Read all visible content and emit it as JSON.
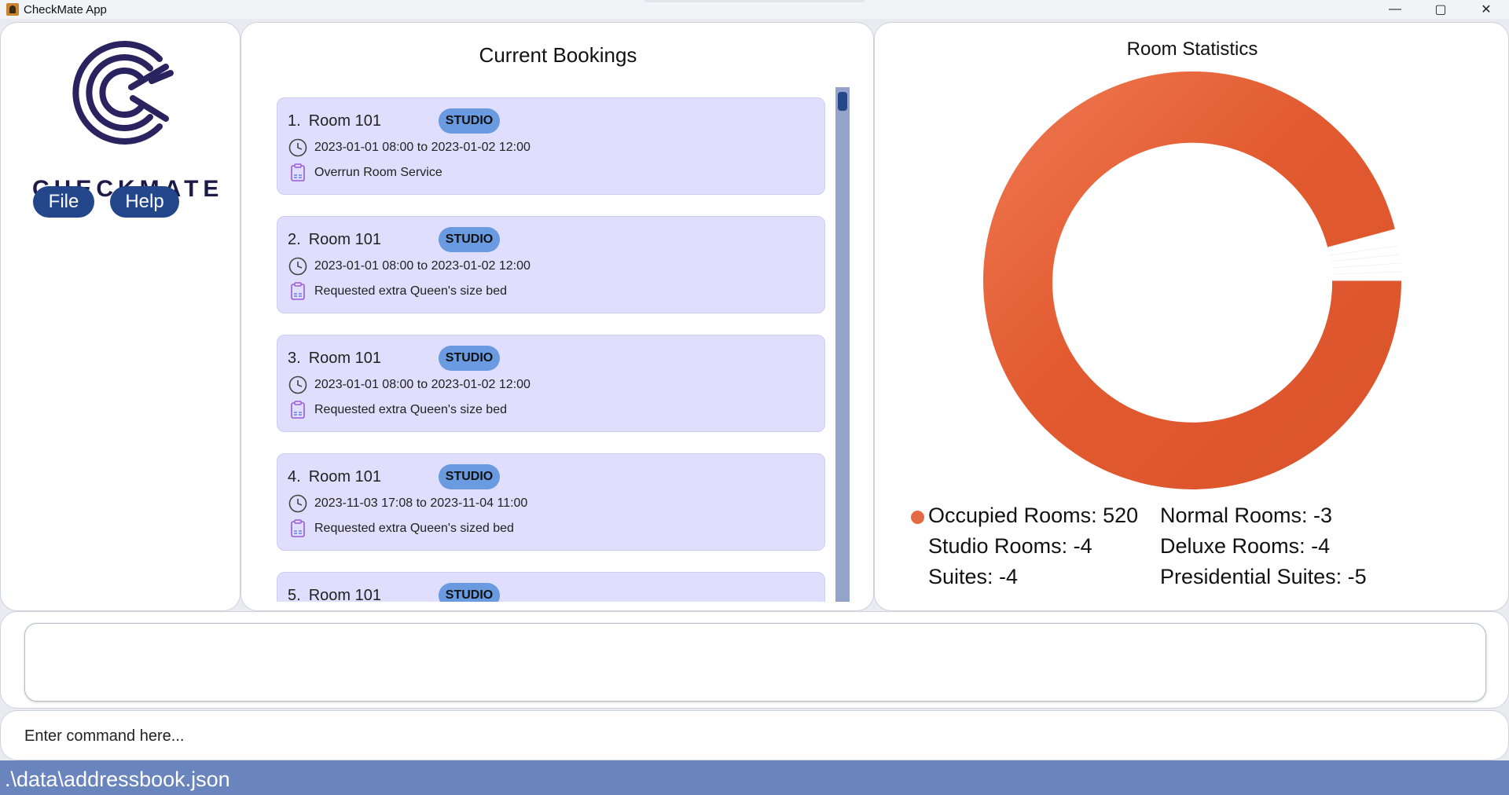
{
  "window": {
    "title": "CheckMate App",
    "controls": [
      "—",
      "▢",
      "✕"
    ]
  },
  "sidebar": {
    "brand": "CHECKMATE",
    "file_label": "File",
    "help_label": "Help"
  },
  "bookings": {
    "title": "Current Bookings",
    "items": [
      {
        "index": "1.",
        "room": "Room 101",
        "type": "STUDIO",
        "period": "2023-01-01 08:00 to 2023-01-02 12:00",
        "note": "Overrun Room Service"
      },
      {
        "index": "2.",
        "room": "Room 101",
        "type": "STUDIO",
        "period": "2023-01-01 08:00 to 2023-01-02 12:00",
        "note": "Requested extra Queen's size bed"
      },
      {
        "index": "3.",
        "room": "Room 101",
        "type": "STUDIO",
        "period": "2023-01-01 08:00 to 2023-01-02 12:00",
        "note": "Requested extra Queen's size bed"
      },
      {
        "index": "4.",
        "room": "Room 101",
        "type": "STUDIO",
        "period": "2023-11-03 17:08 to 2023-11-04 11:00",
        "note": "Requested extra Queen's sized bed"
      },
      {
        "index": "5.",
        "room": "Room 101",
        "type": "STUDIO",
        "period": "",
        "note": ""
      }
    ]
  },
  "stats": {
    "title": "Room Statistics",
    "legend": {
      "occupied": "Occupied Rooms: 520",
      "normal": "Normal Rooms: -3",
      "studio": "Studio Rooms: -4",
      "deluxe": "Deluxe Rooms: -4",
      "suites": "Suites: -4",
      "presidential": "Presidential Suites: -5"
    },
    "colors": {
      "occupied": "#e36a42"
    }
  },
  "command": {
    "placeholder": "Enter command here..."
  },
  "status": {
    "path": ".\\data\\addressbook.json"
  }
}
